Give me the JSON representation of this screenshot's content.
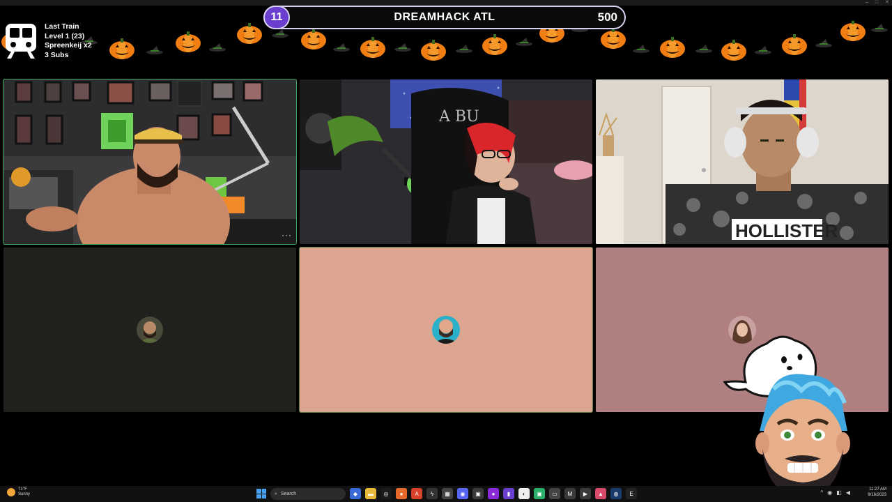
{
  "window": {
    "controls": [
      "–",
      "□",
      "✕"
    ]
  },
  "train": {
    "title": "Last Train",
    "level": "Level 1  (23)",
    "contributor": "Spreenkeij x2",
    "subs": "3 Subs"
  },
  "banner": {
    "badge": "11",
    "title": "DREAMHACK ATL",
    "score": "500",
    "accent": "#6a3fd0"
  },
  "tiles": [
    {
      "name": "participant-1-video",
      "type": "video",
      "speaking": true,
      "more": "···"
    },
    {
      "name": "participant-2-video",
      "type": "video",
      "speaking": false
    },
    {
      "name": "participant-3-video",
      "type": "video",
      "speaking": false
    },
    {
      "name": "participant-4-avatar",
      "type": "avatar",
      "bg": "#22201d"
    },
    {
      "name": "participant-5-avatar",
      "type": "avatar",
      "bg": "#dca58f"
    },
    {
      "name": "participant-6-avatar",
      "type": "avatar",
      "bg": "#b08081"
    }
  ],
  "taskbar": {
    "weather_temp": "71°F",
    "weather_desc": "Sunny",
    "search_placeholder": "Search",
    "time": "11:27 AM",
    "date": "9/16/2023"
  }
}
